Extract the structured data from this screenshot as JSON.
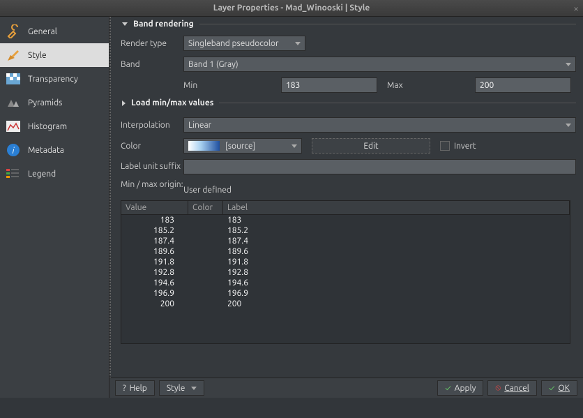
{
  "window": {
    "title": "Layer Properties - Mad_Winooski | Style"
  },
  "sidebar": {
    "items": [
      {
        "label": "General"
      },
      {
        "label": "Style"
      },
      {
        "label": "Transparency"
      },
      {
        "label": "Pyramids"
      },
      {
        "label": "Histogram"
      },
      {
        "label": "Metadata"
      },
      {
        "label": "Legend"
      }
    ]
  },
  "sections": {
    "band_rendering": "Band rendering",
    "load_minmax": "Load min/max values"
  },
  "fields": {
    "render_type_label": "Render type",
    "render_type_value": "Singleband pseudocolor",
    "band_label": "Band",
    "band_value": "Band 1 (Gray)",
    "min_label": "Min",
    "min_value": "183",
    "max_label": "Max",
    "max_value": "200",
    "interpolation_label": "Interpolation",
    "interpolation_value": "Linear",
    "color_label": "Color",
    "color_value": "[source]",
    "edit_button": "Edit",
    "invert_label": "Invert",
    "label_unit_suffix": "Label unit suffix",
    "label_unit_value": "",
    "minmax_origin_label": "Min / max origin:",
    "minmax_origin_value": "User defined"
  },
  "table": {
    "headers": {
      "value": "Value",
      "color": "Color",
      "label": "Label"
    },
    "rows": [
      {
        "value": "183",
        "label": "183"
      },
      {
        "value": "185.2",
        "label": "185.2"
      },
      {
        "value": "187.4",
        "label": "187.4"
      },
      {
        "value": "189.6",
        "label": "189.6"
      },
      {
        "value": "191.8",
        "label": "191.8"
      },
      {
        "value": "192.8",
        "label": "192.8"
      },
      {
        "value": "194.6",
        "label": "194.6"
      },
      {
        "value": "196.9",
        "label": "196.9"
      },
      {
        "value": "200",
        "label": "200"
      }
    ]
  },
  "footer": {
    "help": "Help",
    "style": "Style",
    "apply": "Apply",
    "cancel": "Cancel",
    "ok": "OK"
  }
}
